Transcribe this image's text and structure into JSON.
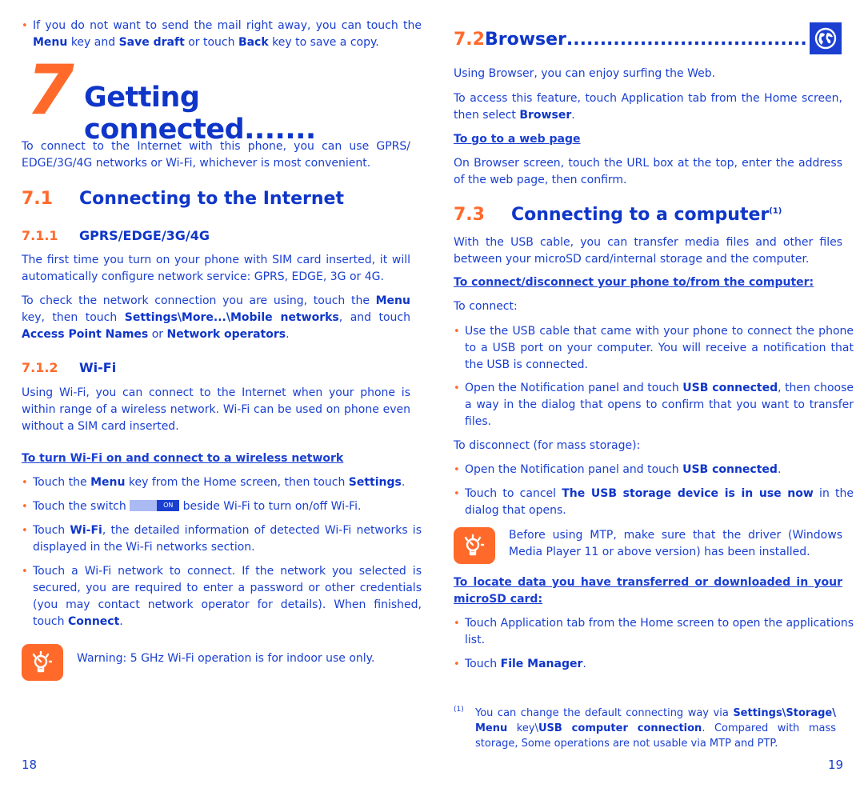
{
  "left_page": {
    "intro_bullet": {
      "t1": "If you do not want to send the mail right away, you can touch the ",
      "b1": "Menu",
      "t2": " key and ",
      "b2": "Save draft",
      "t3": " or touch ",
      "b3": "Back",
      "t4": " key to save a copy."
    },
    "chapter": {
      "number": "7",
      "title": "Getting connected",
      "leader": "......."
    },
    "chapter_intro": "To connect to the Internet with this phone, you can use GPRS/ EDGE/3G/4G networks or Wi-Fi, whichever is most convenient.",
    "section_7_1": {
      "number": "7.1",
      "title": "Connecting to the Internet"
    },
    "section_7_1_1": {
      "number": "7.1.1",
      "title": "GPRS/EDGE/3G/4G"
    },
    "gprs_p1": "The first time you turn on your phone with SIM card inserted, it will automatically configure network service: GPRS, EDGE, 3G or 4G.",
    "gprs_p2": {
      "t1": "To check the network connection you are using, touch the ",
      "b1": "Menu",
      "t2": " key, then touch ",
      "b2": "Settings\\More...\\Mobile networks",
      "t3": ", and touch ",
      "b3": "Access Point Names",
      "t4": " or ",
      "b4": "Network operators",
      "t5": "."
    },
    "section_7_1_2": {
      "number": "7.1.2",
      "title": "Wi-Fi"
    },
    "wifi_p1": "Using Wi-Fi, you can connect to the Internet when your phone is within range of a wireless network. Wi-Fi can be used on phone even without a SIM card inserted.",
    "wifi_heading": "To turn Wi-Fi on and connect to a wireless network",
    "wifi_bullets": [
      {
        "t1": "Touch the ",
        "b1": "Menu",
        "t2": " key from the Home screen, then touch ",
        "b2": "Settings",
        "t3": "."
      },
      {
        "t1": "Touch the switch ",
        "switch_label": "ON",
        "t2": " beside Wi-Fi to turn on/off Wi-Fi."
      },
      {
        "t1": "Touch ",
        "b1": "Wi-Fi",
        "t2": ", the detailed information of detected Wi-Fi networks is displayed in the Wi-Fi networks section."
      },
      {
        "t1": "Touch a Wi-Fi network to connect. If the network you selected is secured, you are required to enter a password or other credentials (you may contact network operator for details). When finished, touch ",
        "b1": "Connect",
        "t2": "."
      }
    ],
    "warning": "Warning: 5 GHz Wi-Fi operation is for indoor use only.",
    "page_number": "18"
  },
  "right_page": {
    "section_7_2": {
      "number": "7.2",
      "title": "Browser",
      "leader": "......................................"
    },
    "browser_p1": "Using Browser, you can enjoy surfing the Web.",
    "browser_p2": {
      "t1": "To access this feature, touch Application tab from the Home screen, then select ",
      "b1": "Browser",
      "t2": "."
    },
    "browser_heading": "To go to a web page",
    "browser_p3": "On Browser screen, touch the URL box at the top, enter the address of the web page, then confirm.",
    "section_7_3": {
      "number": "7.3",
      "title": "Connecting to a computer",
      "sup": "(1)"
    },
    "computer_p1": "With the USB cable, you can transfer media files and other files between your microSD card/internal storage and the computer.",
    "computer_heading": "To connect/disconnect your phone to/from the computer:",
    "to_connect": "To connect:",
    "connect_bullets": [
      {
        "t1": "Use the USB cable that came with your phone to connect the phone to a USB port on your computer. You will receive a notification that the USB is connected."
      },
      {
        "t1": "Open the Notification panel and touch ",
        "b1": "USB connected",
        "t2": ", then choose a way in the dialog that opens to confirm that you want to transfer files."
      }
    ],
    "to_disconnect": "To disconnect (for mass storage):",
    "disconnect_bullets": [
      {
        "t1": "Open the Notification panel and touch ",
        "b1": "USB connected",
        "t2": "."
      },
      {
        "t1": "Touch to cancel ",
        "b1": "The USB storage device is in use now",
        "t2": " in the dialog that opens."
      }
    ],
    "mtp_tip": "Before using MTP, make sure that the driver (Windows Media Player 11 or above version) has been installed.",
    "locate_heading": "To locate data you have transferred or downloaded in your microSD card:",
    "locate_bullets": [
      {
        "t1": "Touch Application tab from the Home screen to open the applications list."
      },
      {
        "t1": "Touch ",
        "b1": "File Manager",
        "t2": "."
      }
    ],
    "footnote": {
      "mark": "(1)",
      "t1": "You can change the default connecting way via ",
      "b1": "Settings\\Storage\\ Menu",
      "t2": " key\\",
      "b2": "USB computer connection",
      "t3": ". Compared with mass storage, Some operations are not usable via MTP and PTP."
    },
    "page_number": "19"
  },
  "colors": {
    "text_blue": "#1a3fd1",
    "heading_blue": "#0f36c8",
    "accent_orange": "#ff6a2b"
  }
}
